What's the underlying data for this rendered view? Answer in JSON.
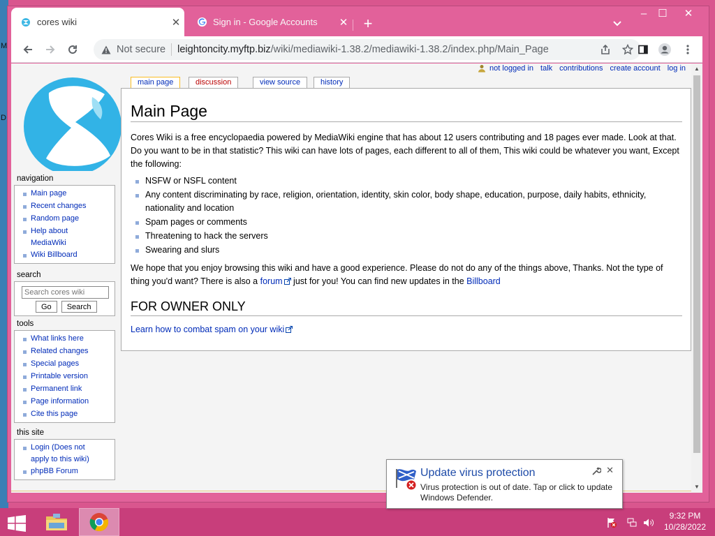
{
  "desktop": {
    "edge_letters": [
      "M",
      "D"
    ]
  },
  "browser": {
    "tabs": [
      {
        "title": "cores wiki",
        "active": true
      },
      {
        "title": "Sign in - Google Accounts",
        "active": false
      }
    ],
    "new_tab_glyph": "+",
    "window_controls": {
      "minimize": "–",
      "maximize": "☐",
      "close": "✕"
    },
    "address_bar": {
      "security_label": "Not secure",
      "host": "leightoncity.myftp.biz",
      "path": "/wiki/mediawiki-1.38.2/mediawiki-1.38.2/index.php/Main_Page"
    }
  },
  "wiki": {
    "personal_tools": {
      "not_logged_in": "not logged in",
      "talk": "talk",
      "contributions": "contributions",
      "create_account": "create account",
      "log_in": "log in"
    },
    "content_tabs": [
      {
        "label": "main page",
        "selected": true
      },
      {
        "label": "discussion",
        "red": true
      },
      {
        "label": "view source"
      },
      {
        "label": "history"
      }
    ],
    "page_title": "Main Page",
    "intro": "Cores Wiki is a free encyclopaedia powered by MediaWiki engine that has about 12 users contributing and 18 pages ever made. Look at that. Do you want to be in that statistic? This wiki can have lots of pages, each different to all of them, This wiki could be whatever you want, Except the following:",
    "rules": [
      "NSFW or NSFL content",
      "Any content discriminating by race, religion, orientation, identity, skin color, body shape, education, purpose, daily habits, ethnicity, nationality and location",
      "Spam pages or comments",
      "Threatening to hack the servers",
      "Swearing and slurs"
    ],
    "outro_part1": "We hope that you enjoy browsing this wiki and have a good experience. Please do not do any of the things above, Thanks. Not the type of thing you'd want? There is also a ",
    "forum_link": "forum",
    "outro_part2": " just for you! You can find new updates in the ",
    "billboard_link": "Billboard",
    "owner_heading": "FOR OWNER ONLY",
    "spam_link": "Learn how to combat spam on your wiki",
    "sidebar": {
      "navigation": {
        "heading": "navigation",
        "items": [
          "Main page",
          "Recent changes",
          "Random page",
          "Help about MediaWiki",
          "Wiki Billboard"
        ]
      },
      "search": {
        "heading": "search",
        "placeholder": "Search cores wiki",
        "go": "Go",
        "search": "Search"
      },
      "tools": {
        "heading": "tools",
        "items": [
          "What links here",
          "Related changes",
          "Special pages",
          "Printable version",
          "Permanent link",
          "Page information",
          "Cite this page"
        ]
      },
      "this_site": {
        "heading": "this site",
        "items": [
          "Login (Does not apply to this wiki)",
          "phpBB Forum"
        ]
      }
    }
  },
  "notification": {
    "title": "Update virus protection",
    "message": "Virus protection is out of date. Tap or click to update Windows Defender."
  },
  "taskbar": {
    "time": "9:32 PM",
    "date": "10/28/2022"
  },
  "colors": {
    "window_chrome": "#e2619a",
    "taskbar": "#c83e7b",
    "link": "#002bb8",
    "redlink": "#ba0000"
  }
}
